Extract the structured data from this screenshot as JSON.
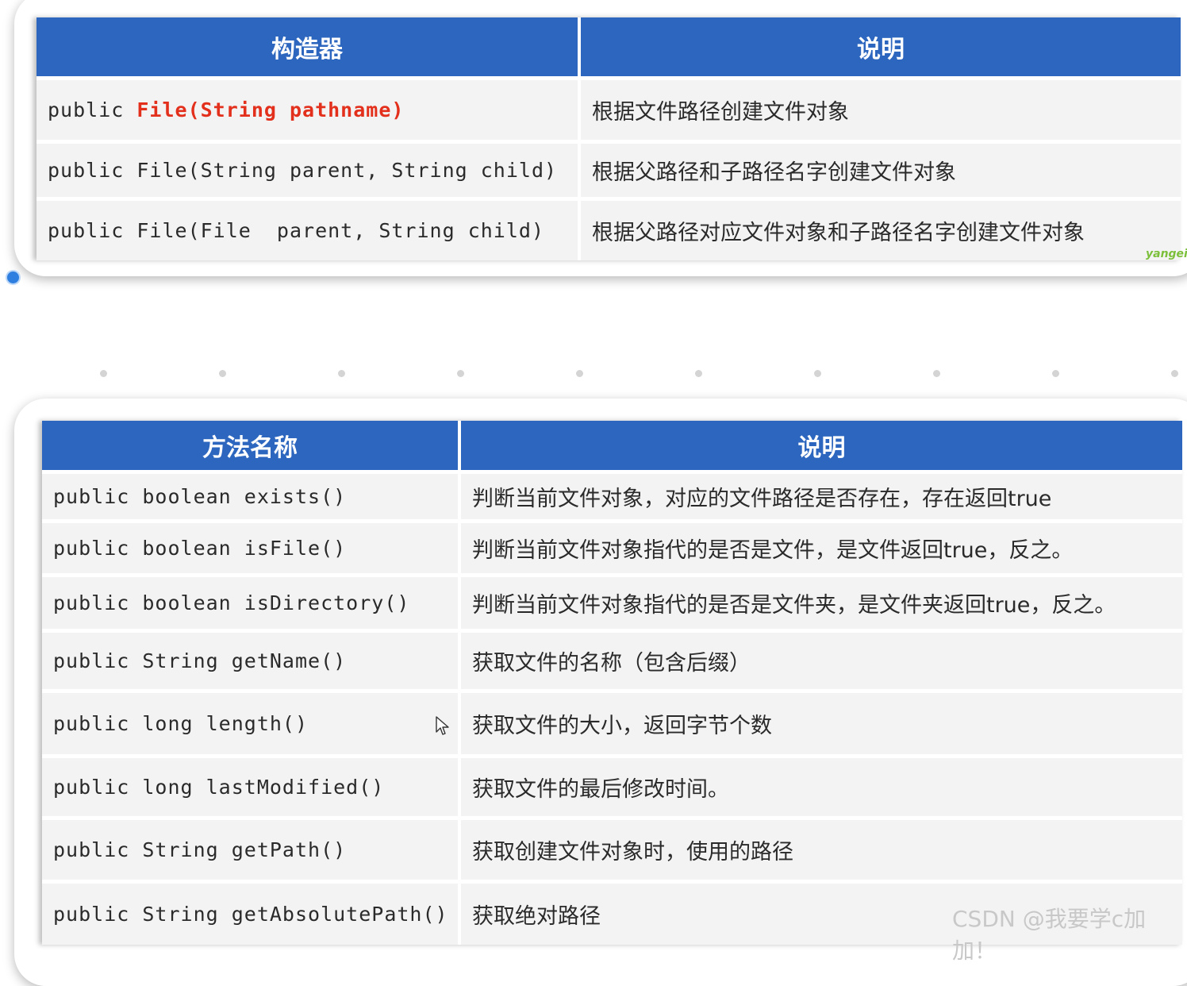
{
  "constructors": {
    "headers": [
      "构造器",
      "说明"
    ],
    "rows": [
      {
        "prefix": "public ",
        "code": "File(String pathname)",
        "desc": "根据文件路径创建文件对象"
      },
      {
        "prefix": "",
        "code": "public File(String parent, String child)",
        "desc": "根据父路径和子路径名字创建文件对象"
      },
      {
        "prefix": "",
        "code": "public File(File  parent, String child)",
        "desc": "根据父路径对应文件对象和子路径名字创建文件对象"
      }
    ]
  },
  "methods": {
    "headers": [
      "方法名称",
      "说明"
    ],
    "rows": [
      {
        "code": "public boolean exists()",
        "desc": "判断当前文件对象，对应的文件路径是否存在，存在返回true"
      },
      {
        "code": "public boolean isFile()",
        "desc": "判断当前文件对象指代的是否是文件，是文件返回true，反之。"
      },
      {
        "code": "public boolean isDirectory()",
        "desc": "判断当前文件对象指代的是否是文件夹，是文件夹返回true，反之。"
      },
      {
        "code": "public String getName()",
        "desc": "获取文件的名称（包含后缀）"
      },
      {
        "code": "public long length()",
        "desc": "获取文件的大小，返回字节个数"
      },
      {
        "code": "public long lastModified()",
        "desc": "获取文件的最后修改时间。"
      },
      {
        "code": "public String getPath()",
        "desc": "获取创建文件对象时，使用的路径"
      },
      {
        "code": "public String getAbsolutePath()",
        "desc": "获取绝对路径"
      }
    ]
  },
  "watermarks": {
    "small": "yangeit",
    "csdn": "CSDN @我要学c加加！"
  },
  "colors": {
    "header_bg": "#2c66bf",
    "highlight": "#e3301c"
  }
}
